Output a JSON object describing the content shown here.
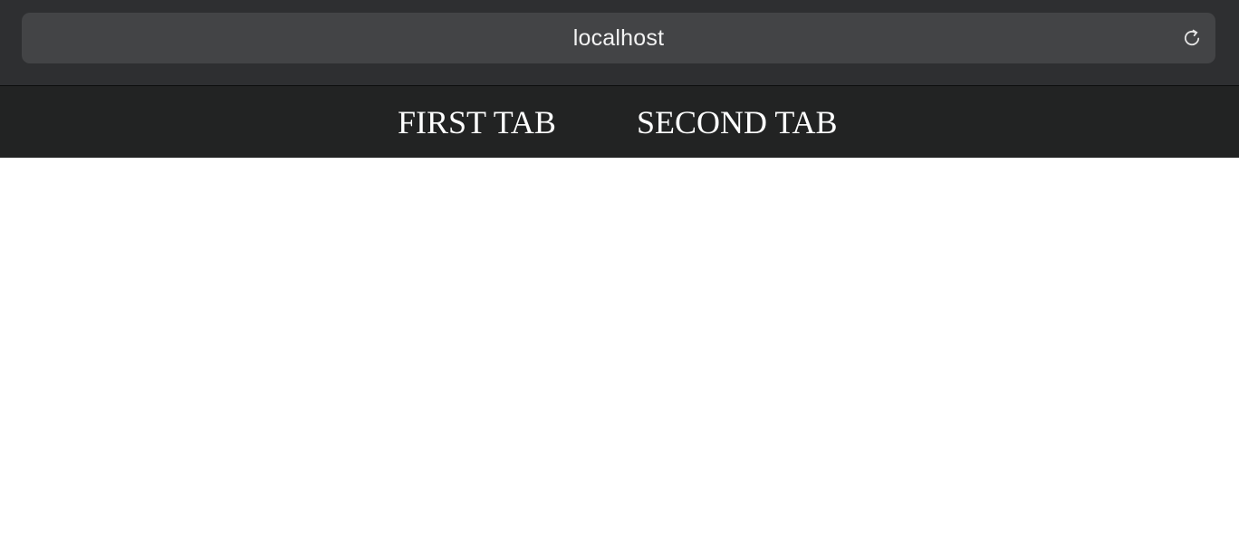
{
  "browser": {
    "url": "localhost",
    "reload_icon": "reload-icon"
  },
  "nav": {
    "tabs": [
      {
        "label": "FIRST TAB"
      },
      {
        "label": "SECOND TAB"
      }
    ]
  },
  "colors": {
    "chrome_background": "#2e2f31",
    "address_bar": "#434446",
    "nav_background": "#222323",
    "nav_text": "#ffffff",
    "content_background": "#ffffff"
  }
}
